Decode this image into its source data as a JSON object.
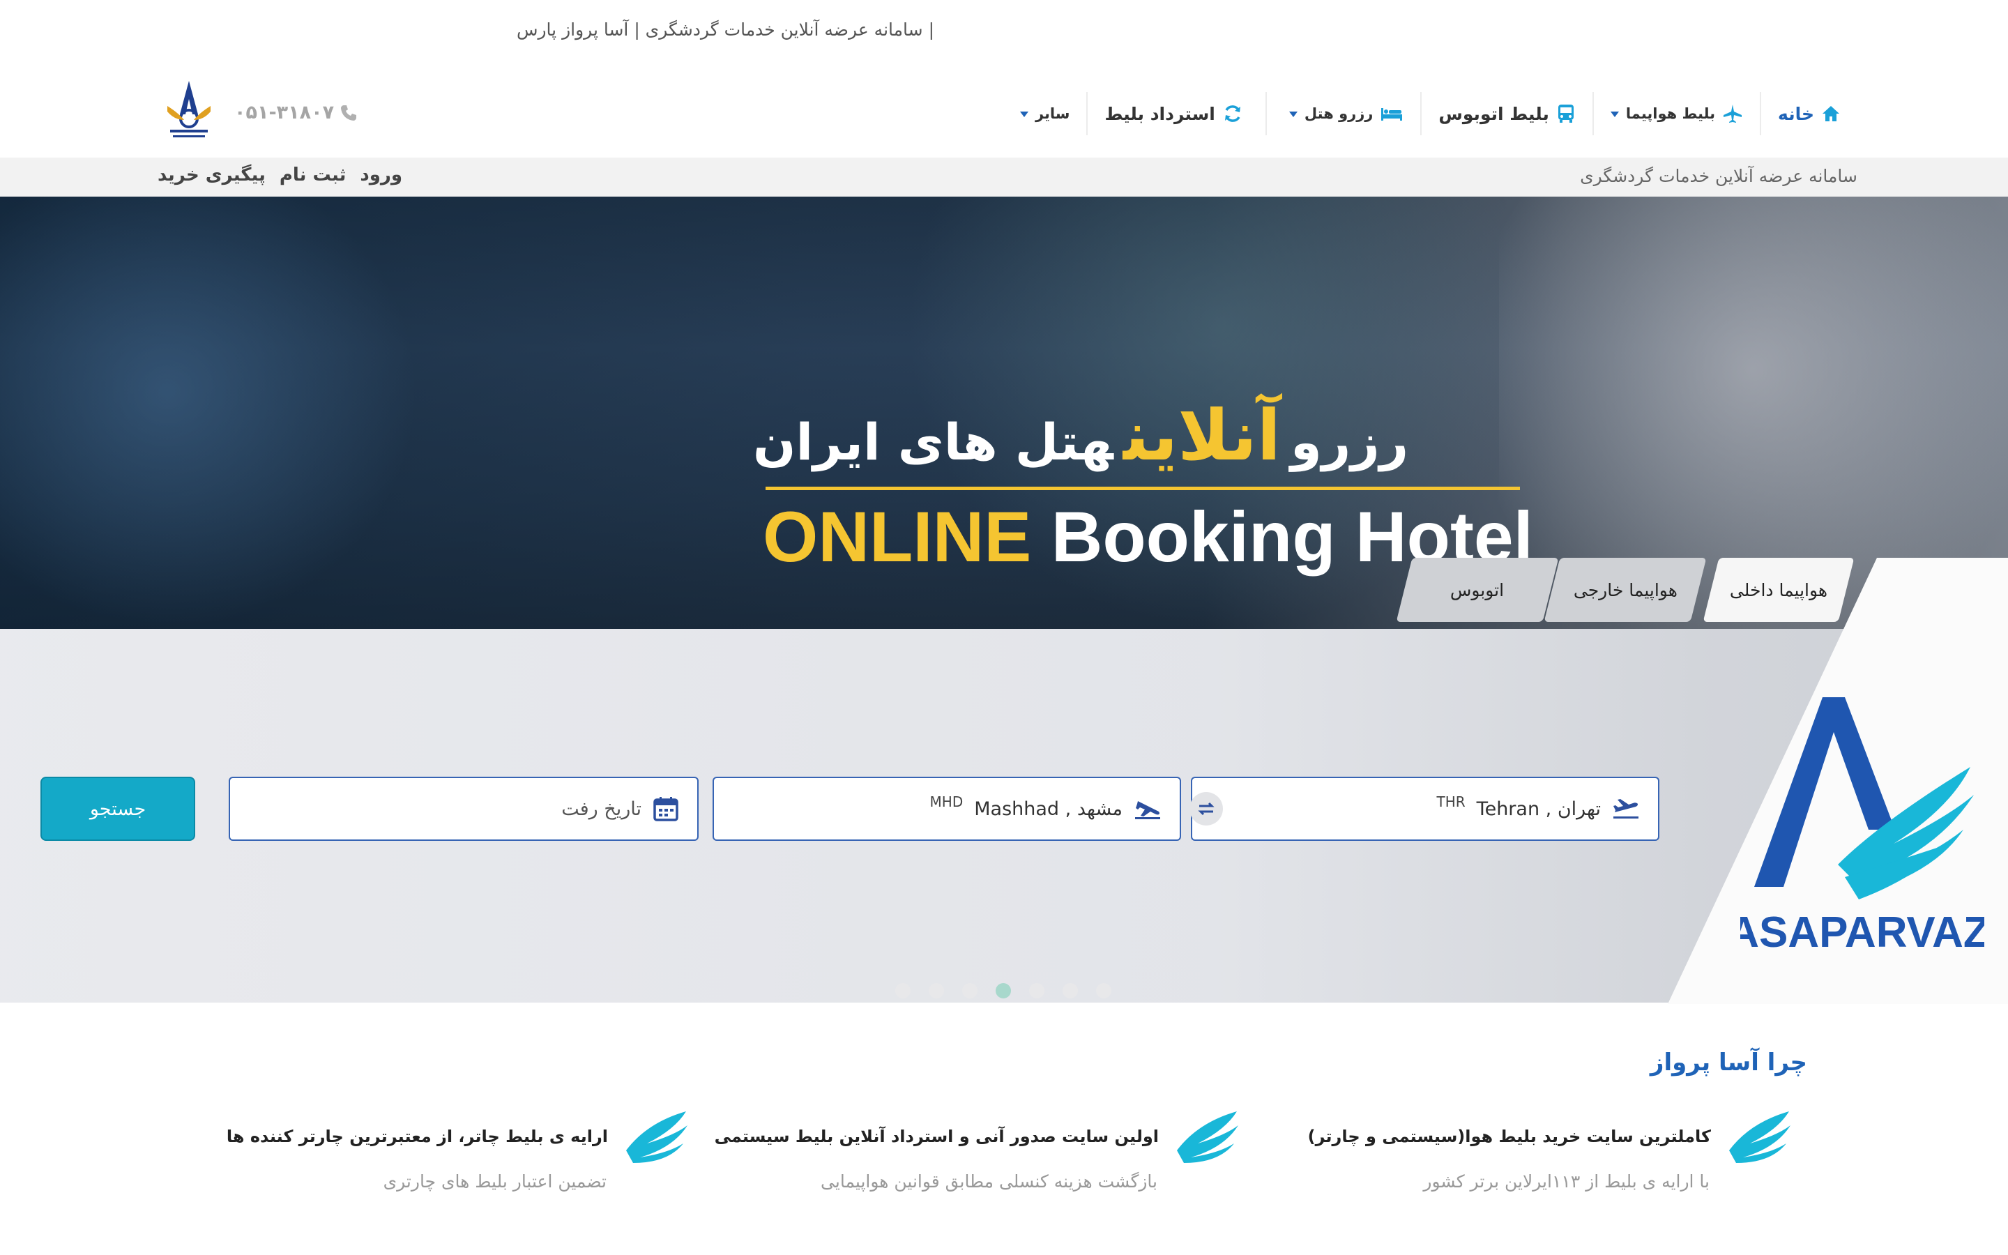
{
  "top": {
    "tagline": "| سامانه عرضه آنلاین خدمات گردشگری  |  آسا پرواز پارس"
  },
  "header": {
    "phone": "۰۵۱-۳۱۸۰۷",
    "nav": [
      {
        "label": "خانه",
        "icon": "home-icon"
      },
      {
        "label": "بلیط هواپیما",
        "icon": "plane-icon"
      },
      {
        "label": "بلیط اتوبوس",
        "icon": "bus-icon"
      },
      {
        "label": "رزرو هتل",
        "icon": "bed-icon"
      },
      {
        "label": "استرداد بلیط",
        "icon": "refresh-icon"
      },
      {
        "label": "سایر",
        "icon": ""
      }
    ],
    "accent": "#1f63b7"
  },
  "strip": {
    "tagline": "سامانه عرضه آنلاین خدمات گردشگری",
    "links": {
      "login": "ورود",
      "register": "ثبت نام",
      "track": "پیگیری خرید"
    }
  },
  "hero": {
    "fa_word1": "رزرو",
    "fa_word2": "آنلاین",
    "fa_word3": "هتل های ایران",
    "en_word1": "ONLINE",
    "en_word2": "Booking Hotel",
    "highlight_color": "#f5c531"
  },
  "search": {
    "tabs": [
      "هواپیما داخلی",
      "هواپیما خارجی",
      "اتوبوس"
    ],
    "active_tab": "هواپیما داخلی",
    "origin": {
      "value": "Tehran , تهران",
      "code": "THR"
    },
    "destination": {
      "value": "Mashhad , مشهد",
      "code": "MHD"
    },
    "date_placeholder": "تاریخ رفت",
    "button": "جستجو",
    "button_color": "#14a9c8",
    "slide_count": 7,
    "active_slide": 4
  },
  "brand": {
    "name": "ASAPARVAZ"
  },
  "why": {
    "title": "چرا آسا پرواز",
    "features": [
      {
        "title": "کاملترین سایت خرید بلیط هوا(سیستمی و چارتر)",
        "subtitle": "با ارایه ی بلیط از ۱۱۳ایرلاین برتر کشور"
      },
      {
        "title": "اولین سایت صدور آنی و استرداد آنلاین بلیط سیستمی",
        "subtitle": "بازگشت هزینه کنسلی مطابق قوانین هواپیمایی"
      },
      {
        "title": "ارایه ی بلیط چاتر، از معتبرترین چارتر کننده ها",
        "subtitle": "تضمین اعتبار بلیط های چارتری"
      }
    ]
  }
}
